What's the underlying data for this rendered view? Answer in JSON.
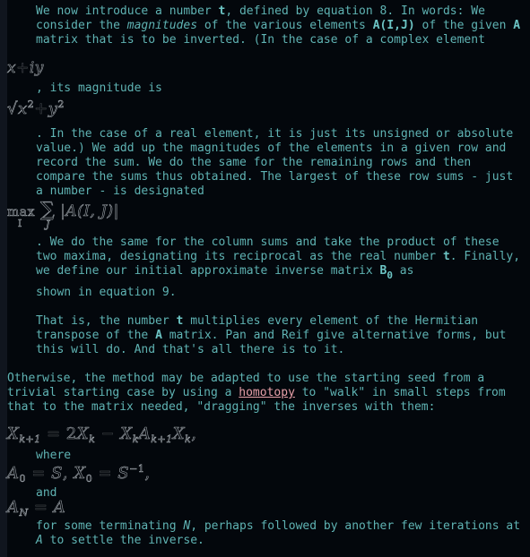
{
  "colors": {
    "background": "#03070c",
    "left_strip": "#10151e",
    "text": "#5fb3b3",
    "link": "#e8a0a8",
    "math": "#9aa0a6"
  },
  "paragraph1": {
    "p1": "We now introduce a number ",
    "t": "t",
    "p2": ", defined by equation 8. In words: We consider the ",
    "magnitudes": "magnitudes",
    "p3": " of the various elements ",
    "aij": "A(I,J)",
    "p4": " of the given ",
    "a": "A",
    "p5": " matrix that is to be inverted. (In the case of a complex element"
  },
  "formula_complex": {
    "x": "x",
    "plus": "+",
    "iy": "iy"
  },
  "magnitude_line": ", its magnitude is",
  "formula_sqrt": {
    "root": "√",
    "x": "x",
    "sq1": "2",
    "plus": "+",
    "y": "y",
    "sq2": "2"
  },
  "paragraph2": ". In the case of a real element, it is just its unsigned or absolute value.) We add up the magnitudes of the elements in a given row and record the sum. We do the same for the remaining rows and then compare the sums thus obtained. The largest of these row sums - just a number - is designated",
  "formula_max": {
    "max": "max",
    "max_sub": "I",
    "sum": "∑",
    "sum_sub": "J",
    "abs": "|A(I, J)|"
  },
  "paragraph3": {
    "p1": ". We do the same for the column sums and take the product of these two maxima, designating its reciprocal as the real number ",
    "t": "t",
    "p2": ". Finally, we define our initial approximate inverse matrix ",
    "b": "B",
    "b_sub": "0",
    "p3": " as",
    "p4": "shown in equation 9."
  },
  "paragraph4": {
    "p1": "That is, the number ",
    "t": "t",
    "p2": " multiplies every element of the Hermitian transpose of the ",
    "a": "A",
    "p3": " matrix. Pan and Reif give alternative forms, but this will do. And that's all there is to it."
  },
  "paragraph5": {
    "p1": "Otherwise, the method may be adapted to use the starting seed from a trivial starting case by using a ",
    "link": "homotopy",
    "p2": " to \"walk\" in small steps from that to the matrix needed, \"dragging\" the inverses with them:"
  },
  "formula_iter": {
    "x1": "X",
    "x1_sub": "k+1",
    "eq": "=",
    "two": "2",
    "x2": "X",
    "x2_sub": "k",
    "minus": "−",
    "x3": "X",
    "x3_sub": "k",
    "a": "A",
    "a_sub": "k+1",
    "x4": "X",
    "x4_sub": "k",
    "comma": ","
  },
  "where_label": "where",
  "formula_init": {
    "a": "A",
    "a_sub": "0",
    "eq1": "=",
    "s1": "S",
    "comma1": ",",
    "x": "X",
    "x_sub": "0",
    "eq2": "=",
    "s2": "S",
    "s2_sup": "−1",
    "comma2": ","
  },
  "and_label": "and",
  "formula_final": {
    "a": "A",
    "a_sub": "N",
    "eq": "=",
    "rhs": "A"
  },
  "paragraph6": {
    "p1": "for some terminating ",
    "n": "N",
    "p2": ", perhaps followed by another few iterations at ",
    "a": "A",
    "p3": " to settle the inverse."
  }
}
